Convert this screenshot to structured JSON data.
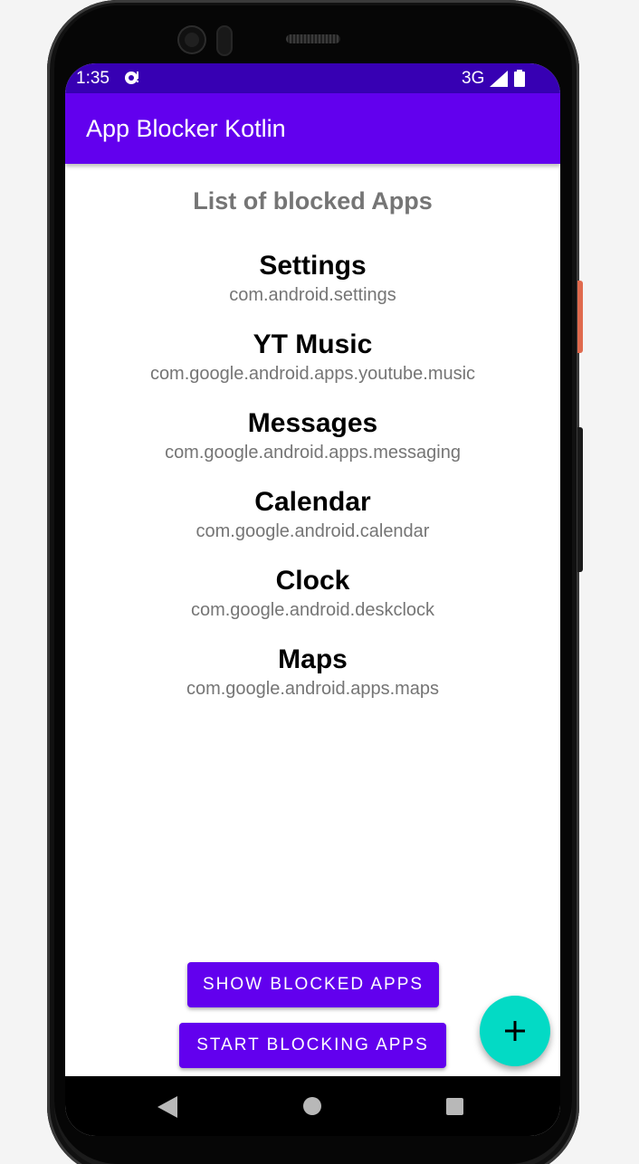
{
  "status_bar": {
    "time": "1:35",
    "network": "3G",
    "notification_icon": "notification-icon",
    "signal_icon": "signal-icon",
    "battery_icon": "battery-icon"
  },
  "app_bar": {
    "title": "App Blocker Kotlin"
  },
  "main": {
    "heading": "List of blocked Apps",
    "apps": [
      {
        "name": "Settings",
        "package": "com.android.settings"
      },
      {
        "name": "YT Music",
        "package": "com.google.android.apps.youtube.music"
      },
      {
        "name": "Messages",
        "package": "com.google.android.apps.messaging"
      },
      {
        "name": "Calendar",
        "package": "com.google.android.calendar"
      },
      {
        "name": "Clock",
        "package": "com.google.android.deskclock"
      },
      {
        "name": "Maps",
        "package": "com.google.android.apps.maps"
      }
    ]
  },
  "buttons": {
    "show_blocked": "SHOW BLOCKED APPS",
    "start_blocking": "START BLOCKING APPS",
    "fab_icon": "plus-icon"
  },
  "nav_bar": {
    "back_icon": "back-triangle-icon",
    "home_icon": "home-circle-icon",
    "recents_icon": "recents-square-icon"
  },
  "colors": {
    "status_bar": "#3700b3",
    "primary": "#6200ee",
    "fab": "#03dac5",
    "heading_text": "#757575"
  }
}
